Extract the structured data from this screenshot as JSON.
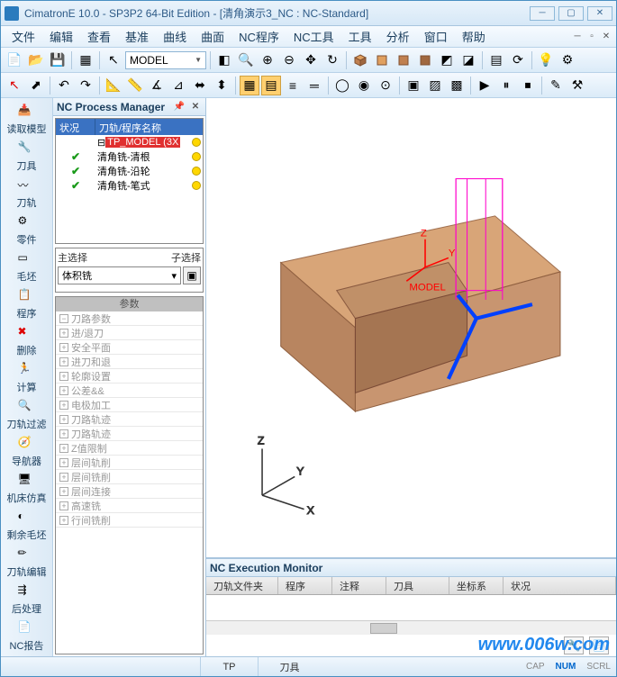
{
  "titlebar": {
    "title": "CimatronE 10.0 - SP3P2 64-Bit Edition - [清角演示3_NC : NC-Standard]"
  },
  "menu": {
    "items": [
      "文件",
      "编辑",
      "查看",
      "基准",
      "曲线",
      "曲面",
      "NC程序",
      "NC工具",
      "工具",
      "分析",
      "窗口",
      "帮助"
    ]
  },
  "toolbar1": {
    "dropdown": "MODEL"
  },
  "sidebar": {
    "items": [
      {
        "label": "读取模型"
      },
      {
        "label": "刀具"
      },
      {
        "label": "刀轨"
      },
      {
        "label": "零件"
      },
      {
        "label": "毛坯"
      },
      {
        "label": "程序"
      },
      {
        "label": "删除"
      },
      {
        "label": "计算"
      },
      {
        "label": "刀轨过滤"
      },
      {
        "label": "导航器"
      },
      {
        "label": "机床仿真"
      },
      {
        "label": "剩余毛坯"
      },
      {
        "label": "刀轨编辑"
      },
      {
        "label": "后处理"
      },
      {
        "label": "NC报告"
      }
    ]
  },
  "proc_panel": {
    "title": "NC Process Manager",
    "headers": {
      "col1": "状况",
      "col2": "刀轨/程序名称"
    },
    "rows": [
      {
        "name": "TP_MODEL (3X",
        "selected": true
      },
      {
        "name": "清角铣-清根"
      },
      {
        "name": "清角铣-沿轮"
      },
      {
        "name": "清角铣-笔式"
      }
    ]
  },
  "sel_panel": {
    "label_main": "主选择",
    "label_sub": "子选择",
    "value": "体积铣"
  },
  "param_panel": {
    "header": "参数",
    "rows": [
      "刀路参数",
      "进/退刀",
      "安全平面",
      "进刀和退",
      "轮廓设置",
      "公差&&",
      "电极加工",
      "刀路轨迹",
      "刀路轨迹",
      "Z值限制",
      "层间轨削",
      "层间铣削",
      "层间连接",
      "高速铣",
      "行间铣削"
    ]
  },
  "exec_monitor": {
    "title": "NC Execution Monitor",
    "headers": [
      "刀轨文件夹",
      "程序",
      "注释",
      "刀具",
      "坐标系",
      "状况"
    ]
  },
  "statusbar": {
    "cells": [
      "TP",
      "刀具"
    ],
    "indicators": [
      "CAP",
      "NUM",
      "SCRL"
    ]
  },
  "viewport": {
    "model_label": "MODEL",
    "axis_z": "Z",
    "axis_y": "Y",
    "axis_x": "X"
  },
  "watermark": "www.006w.com"
}
